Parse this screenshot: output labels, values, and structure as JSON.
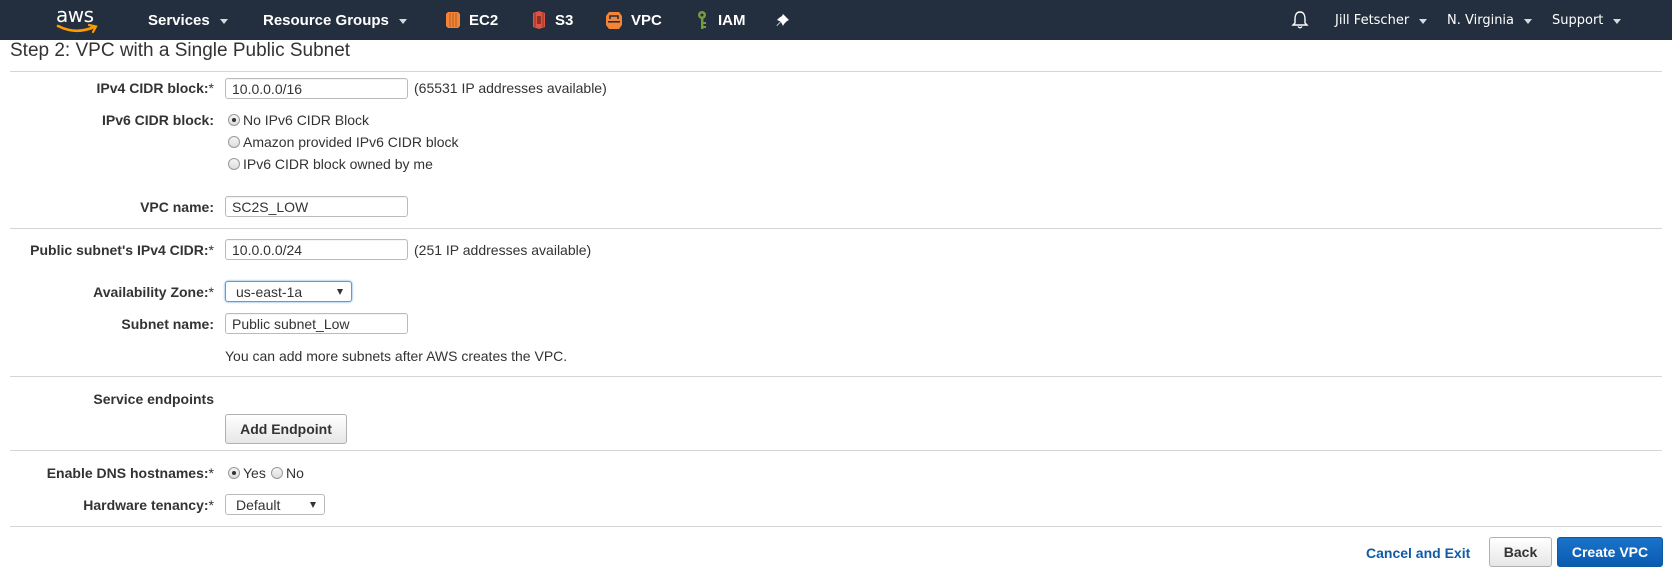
{
  "nav": {
    "logo": "aws",
    "services": "Services",
    "resource_groups": "Resource Groups",
    "shortcuts": [
      {
        "label": "EC2",
        "icon": "ec2-icon",
        "color": "#f58536"
      },
      {
        "label": "S3",
        "icon": "s3-icon",
        "color": "#e05243"
      },
      {
        "label": "VPC",
        "icon": "vpc-icon",
        "color": "#f58536"
      },
      {
        "label": "IAM",
        "icon": "iam-key-icon",
        "color": "#759c3e"
      }
    ],
    "user": "Jill Fetscher",
    "region": "N. Virginia",
    "support": "Support"
  },
  "page": {
    "title": "Step 2: VPC with a Single Public Subnet"
  },
  "form": {
    "ipv4_cidr": {
      "label": "IPv4 CIDR block:",
      "required": "*",
      "value": "10.0.0.0/16",
      "hint": "(65531 IP addresses available)"
    },
    "ipv6_cidr": {
      "label": "IPv6 CIDR block:",
      "options": [
        "No IPv6 CIDR Block",
        "Amazon provided IPv6 CIDR block",
        "IPv6 CIDR block owned by me"
      ],
      "selected": 0
    },
    "vpc_name": {
      "label": "VPC name:",
      "value": "SC2S_LOW"
    },
    "subnet_cidr": {
      "label": "Public subnet's IPv4 CIDR:",
      "required": "*",
      "value": "10.0.0.0/24",
      "hint": "(251 IP addresses available)"
    },
    "availability_zone": {
      "label": "Availability Zone:",
      "required": "*",
      "value": "us-east-1a"
    },
    "subnet_name": {
      "label": "Subnet name:",
      "value": "Public subnet_Low"
    },
    "subnet_note": "You can add more subnets after AWS creates the VPC.",
    "service_endpoints": {
      "label": "Service endpoints",
      "button": "Add Endpoint"
    },
    "dns_hostnames": {
      "label": "Enable DNS hostnames:",
      "required": "*",
      "options": [
        "Yes",
        "No"
      ],
      "selected": 0
    },
    "hardware_tenancy": {
      "label": "Hardware tenancy:",
      "required": "*",
      "value": "Default"
    }
  },
  "actions": {
    "cancel": "Cancel and Exit",
    "back": "Back",
    "create": "Create VPC"
  },
  "colors": {
    "nav_bg": "#232f3e",
    "primary": "#0a5bb0",
    "link": "#0f5ba7",
    "logo_smile": "#ff9900"
  }
}
